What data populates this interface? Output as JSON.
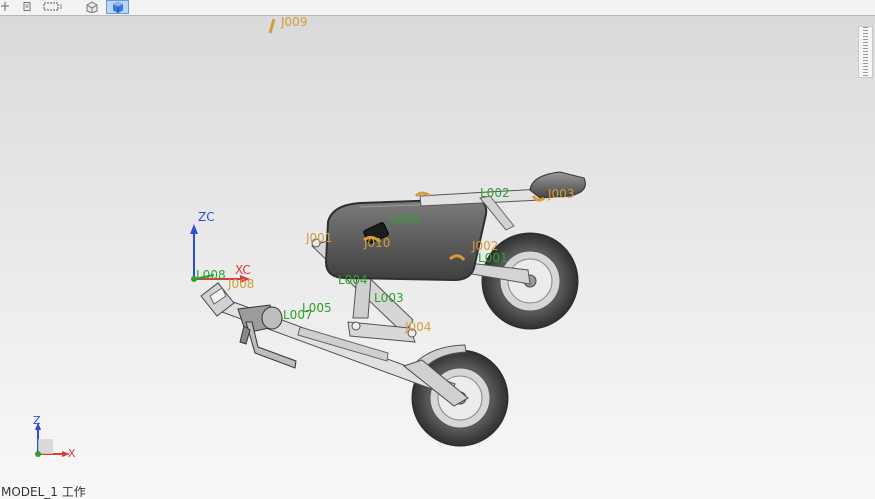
{
  "toolbar": {
    "icons": [
      "snap-grid-icon",
      "list-icon",
      "select-box-icon",
      "wireframe-cube-icon",
      "shaded-cube-icon"
    ]
  },
  "viewport": {
    "labels": {
      "j009": "J009",
      "l002": "L002",
      "j003": "J003",
      "l009": "L009",
      "j001": "J001",
      "j010": "J010",
      "l001": "L001",
      "l004": "L004",
      "l003": "L003",
      "l005": "L005",
      "l007": "L007",
      "j004": "J004",
      "j002": "J002",
      "l008": "L008",
      "j008": "J008"
    },
    "wcs": {
      "z": "ZC",
      "x": "XC"
    },
    "triad": {
      "z": "Z",
      "x": "X"
    }
  },
  "status": {
    "work_part": "MODEL_1 工作"
  },
  "colors": {
    "link_label": "#2ea22e",
    "joint_label": "#d79b3a",
    "axis_z": "#2d4fd8",
    "axis_x": "#d83c3c"
  }
}
